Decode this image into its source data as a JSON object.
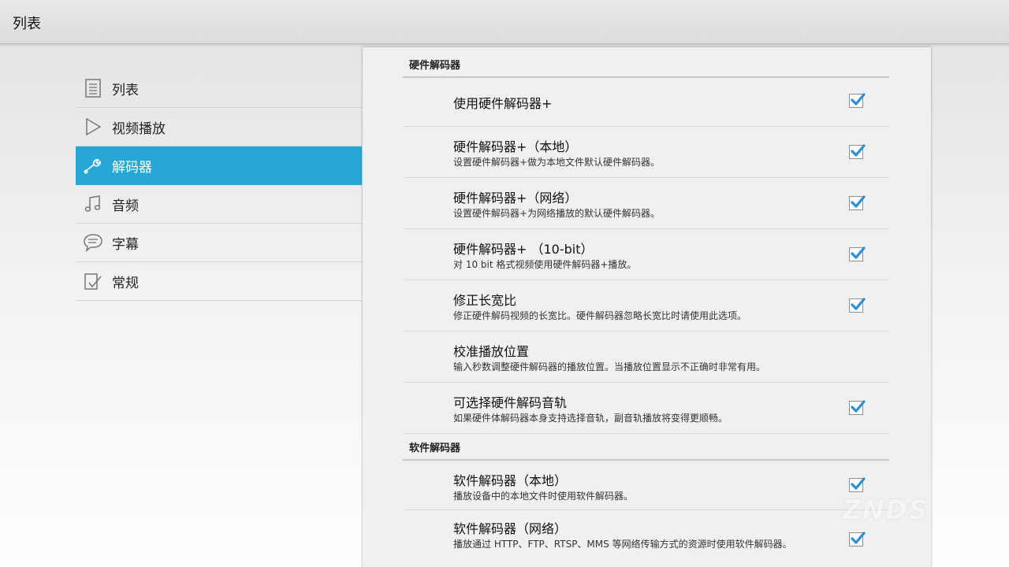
{
  "actionbar": {
    "title": "列表"
  },
  "sidebar": {
    "items": [
      {
        "label": "列表",
        "icon": "list-icon",
        "selected": false
      },
      {
        "label": "视频播放",
        "icon": "play-icon",
        "selected": false
      },
      {
        "label": "解码器",
        "icon": "wrench-icon",
        "selected": true
      },
      {
        "label": "音频",
        "icon": "music-note-icon",
        "selected": false
      },
      {
        "label": "字幕",
        "icon": "speech-bubble-icon",
        "selected": false
      },
      {
        "label": "常规",
        "icon": "check-document-icon",
        "selected": false
      }
    ]
  },
  "sections": {
    "hw": {
      "header": "硬件解码器"
    },
    "sw": {
      "header": "软件解码器"
    }
  },
  "prefs": [
    {
      "title": "使用硬件解码器+",
      "summary": "",
      "checked": true
    },
    {
      "title": "硬件解码器+（本地）",
      "summary": "设置硬件解码器+做为本地文件默认硬件解码器。",
      "checked": true
    },
    {
      "title": "硬件解码器+（网络）",
      "summary": "设置硬件解码器+为网络播放的默认硬件解码器。",
      "checked": true
    },
    {
      "title": "硬件解码器+ （10-bit）",
      "summary": "对 10 bit 格式视频使用硬件解码器+播放。",
      "checked": true
    },
    {
      "title": "修正长宽比",
      "summary": "修正硬件解码视频的长宽比。硬件解码器忽略长宽比时请使用此选项。",
      "checked": true
    },
    {
      "title": "校准播放位置",
      "summary": "输入秒数调整硬件解码器的播放位置。当播放位置显示不正确时非常有用。",
      "checked": null
    },
    {
      "title": "可选择硬件解码音轨",
      "summary": "如果硬件体解码器本身支持选择音轨，副音轨播放将变得更顺畅。",
      "checked": true
    },
    {
      "title": "软件解码器（本地）",
      "summary": "播放设备中的本地文件时使用软件解码器。",
      "checked": true
    },
    {
      "title": "软件解码器（网络）",
      "summary": "播放通过 HTTP、FTP、RTSP、MMS 等网络传输方式的资源时使用软件解码器。",
      "checked": true
    }
  ],
  "watermark": {
    "text": "ZNDS"
  },
  "colors": {
    "accent": "#26a7d6",
    "check": "#2b8fd1"
  }
}
